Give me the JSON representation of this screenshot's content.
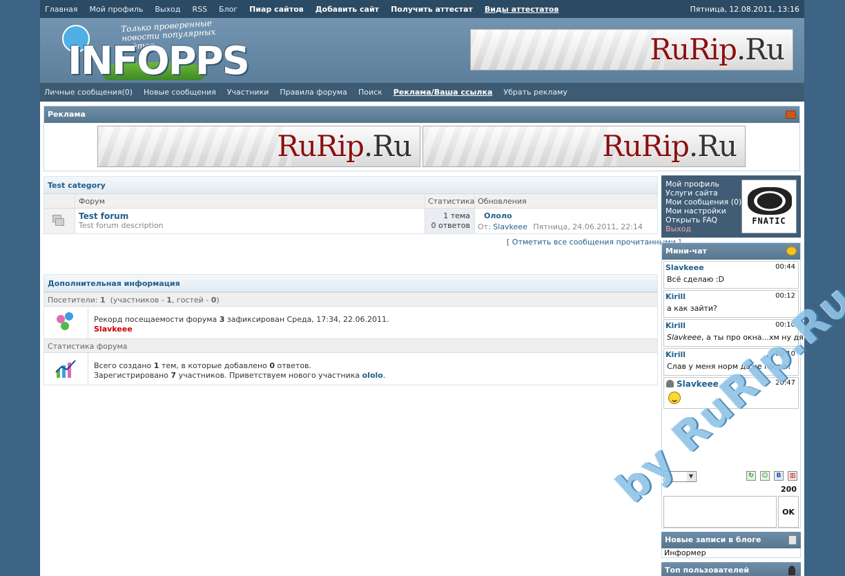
{
  "topnav": {
    "items": [
      {
        "label": "Главная"
      },
      {
        "label": "Мой профиль"
      },
      {
        "label": "Выход"
      },
      {
        "label": "RSS"
      },
      {
        "label": "Блог"
      },
      {
        "label": "Пиар сайтов"
      },
      {
        "label": "Добавить сайт"
      },
      {
        "label": "Получить аттестат"
      },
      {
        "label": "Виды аттестатов"
      }
    ],
    "date": "Пятница, 12.08.2011, 13:16"
  },
  "header": {
    "logo_text": "INFOPPS",
    "tagline": "Только проверенные новости популярных сайтов",
    "banner": {
      "text": "RuRip",
      "dot": ".Ru"
    }
  },
  "nav2": {
    "items": [
      {
        "label": "Личные сообщения(0)"
      },
      {
        "label": "Новые сообщения"
      },
      {
        "label": "Участники"
      },
      {
        "label": "Правила форума"
      },
      {
        "label": "Поиск"
      },
      {
        "label": "Реклама/Ваша ссылка"
      },
      {
        "label": "Убрать рекламу"
      }
    ]
  },
  "ads": {
    "title": "Реклама",
    "banner1": {
      "text": "RuRip",
      "dot": ".Ru"
    },
    "banner2": {
      "text": "RuRip",
      "dot": ".Ru"
    }
  },
  "forum": {
    "category": "Test category",
    "columns": {
      "forum": "Форум",
      "stats": "Статистика",
      "updates": "Обновления"
    },
    "rows": [
      {
        "name": "Test forum",
        "desc": "Test forum description",
        "topics": "1 тема",
        "replies": "0 ответов",
        "last_title": "Ололо",
        "from_label": "От:",
        "last_author": "Slavkeee",
        "last_date": "Пятница, 24.06.2011, 22:14"
      }
    ],
    "mark_all": "[ Отметить все сообщения прочитанными ]"
  },
  "info": {
    "title": "Дополнительная информация",
    "visitors": {
      "prefix": "Посетители:",
      "total": "1",
      "open": "(участников -",
      "members": "1",
      "guests_label": ", гостей -",
      "guests": "0",
      "close": ")"
    },
    "record": {
      "pre": "Рекорд посещаемости форума",
      "count": "3",
      "post": "зафиксирован Среда, 17:34, 22.06.2011.",
      "user": "Slavkeee"
    },
    "stats_title": "Статистика форума",
    "stats": {
      "l1_pre": "Всего создано",
      "topics": "1",
      "l1_mid": "тем, в которые добавлено",
      "replies": "0",
      "l1_post": "ответов.",
      "l2_pre": "Зарегистрировано",
      "users": "7",
      "l2_mid": "участников. Приветствуем нового участника",
      "newest": "ololo",
      "l2_post": "."
    }
  },
  "userbox": {
    "links": [
      {
        "label": "Мой профиль"
      },
      {
        "label": "Услуги сайта"
      },
      {
        "label": "Мои сообщения (0)"
      },
      {
        "label": "Мои настройки"
      },
      {
        "label": "Открыть FAQ"
      },
      {
        "label": "Выход"
      }
    ],
    "avatar_text": "FNATIC"
  },
  "chat": {
    "title": "Мини-чат",
    "messages": [
      {
        "user": "Slavkeee",
        "time": "00:44",
        "text": "Всё сделаю :D"
      },
      {
        "user": "Kirill",
        "time": "00:12",
        "text": "а как зайти?"
      },
      {
        "user": "Kirill",
        "time": "00:10",
        "quote": "Slavkeee",
        "text": ", а ты про окна...хм ну дя"
      },
      {
        "user": "Kirill",
        "time": "00:10",
        "text": "Слав у меня норм даже гостю!"
      },
      {
        "user": "Slavkeee",
        "time": "20:47",
        "text": ""
      }
    ],
    "select_value": "--",
    "char_count": "200",
    "ok_label": "OK",
    "toolbar": {
      "b": "B"
    }
  },
  "blog": {
    "title": "Новые записи в блоге",
    "body": "Информер"
  },
  "top_users": {
    "title": "Топ пользователей"
  },
  "watermark": "by RuRip.Ru"
}
